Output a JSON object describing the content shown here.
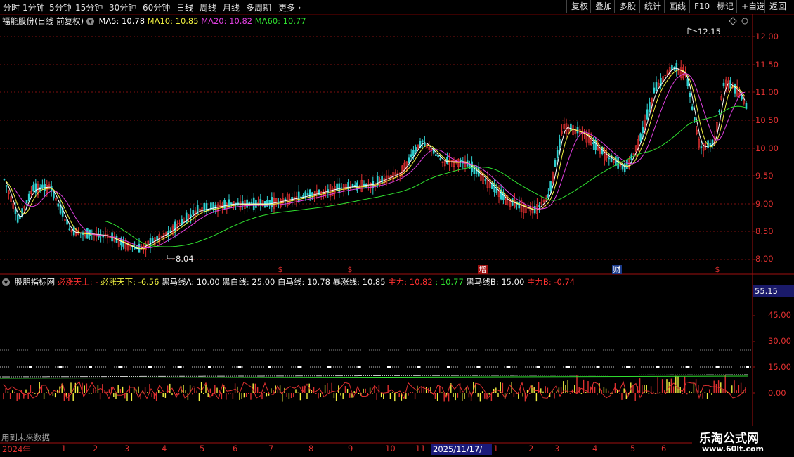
{
  "toolbar": {
    "timeframes": [
      "分时",
      "1分钟",
      "5分钟",
      "15分钟",
      "30分钟",
      "60分钟",
      "日线",
      "周线",
      "月线",
      "多周期",
      "更多"
    ],
    "buttons": [
      "复权",
      "叠加",
      "多股",
      "统计",
      "画线",
      "F10",
      "标记",
      "+自选",
      "返回"
    ]
  },
  "price_header": {
    "title": "福能股份(日线 前复权)",
    "ma5": "MA5: 10.78",
    "ma10": "MA10: 10.85",
    "ma20": "MA20: 10.82",
    "ma60": "MA60: 10.77"
  },
  "price_axis": [
    "12.00",
    "11.50",
    "11.00",
    "10.50",
    "10.00",
    "9.50",
    "9.00",
    "8.50",
    "8.00"
  ],
  "price_marks": {
    "high": "12.15",
    "low": "8.04"
  },
  "events": [
    "$",
    "$",
    "增",
    "财",
    "$"
  ],
  "indicator_header": {
    "name": "股朋指标网",
    "items": [
      {
        "label": "必涨天上: -",
        "color": "#ff3030"
      },
      {
        "label": "必涨天下: -6.56",
        "color": "#f0f040"
      },
      {
        "label": "黑马线A: 10.00",
        "color": "#f0f0f0"
      },
      {
        "label": "黑白线: 25.00",
        "color": "#f0f0f0"
      },
      {
        "label": "白马线: 10.78",
        "color": "#f0f0f0"
      },
      {
        "label": "暴涨线: 10.85",
        "color": "#f0f0f0"
      },
      {
        "label": "主力: 10.82",
        "color": "#ff3030"
      },
      {
        "label": ": 10.77",
        "color": "#30e030"
      },
      {
        "label": "黑马线B: 15.00",
        "color": "#f0f0f0"
      },
      {
        "label": "主力B: -0.74",
        "color": "#ff3030"
      }
    ]
  },
  "indicator_axis": {
    "current": "55.15",
    "ticks": [
      "45.00",
      "30.00",
      "15.00",
      "0.00"
    ]
  },
  "footer_note": "用到未来数据",
  "dates": {
    "year": "2024年",
    "months": [
      "1",
      "2",
      "3",
      "4",
      "5",
      "6",
      "7",
      "8",
      "9",
      "10",
      "11"
    ],
    "cursor_date": "2025/11/17/一",
    "after": [
      "1",
      "2",
      "3",
      "4",
      "5",
      "6"
    ]
  },
  "watermark": {
    "line1": "乐淘公式网",
    "line2": "www.60lt.com"
  },
  "colors": {
    "ma5": "#ffffff",
    "ma10": "#f0f040",
    "ma20": "#e040e0",
    "ma60": "#30e030",
    "up": "#e03030",
    "down": "#30d0d0"
  }
}
